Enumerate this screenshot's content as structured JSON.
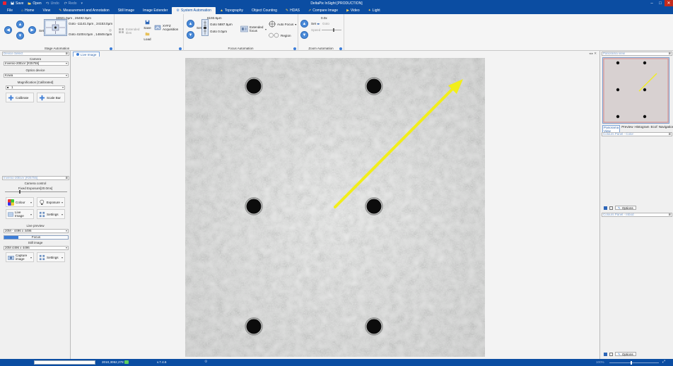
{
  "titlebar": {
    "title": "DeltaPix InSight  [PRODUCTION]",
    "quick": [
      {
        "label": "Save",
        "icon": "save-icon"
      },
      {
        "label": "Open",
        "icon": "folder-icon"
      },
      {
        "label": "Undo",
        "icon": "undo-icon"
      },
      {
        "label": "Redo",
        "icon": "redo-icon"
      }
    ]
  },
  "menu": {
    "tabs": [
      {
        "label": "File",
        "icon": ""
      },
      {
        "label": "Home",
        "icon": "home-icon"
      },
      {
        "label": "View",
        "icon": ""
      },
      {
        "label": "Measurement and Annotation",
        "icon": "ruler-icon"
      },
      {
        "label": "Still Image",
        "icon": ""
      },
      {
        "label": "Image Extender",
        "icon": ""
      },
      {
        "label": "System Automation",
        "icon": "gear-icon"
      },
      {
        "label": "Topography",
        "icon": "mountain-icon"
      },
      {
        "label": "Object Counting",
        "icon": ""
      },
      {
        "label": "HDAS",
        "icon": "pen-icon"
      },
      {
        "label": "Compare Image",
        "icon": "arrow-icon"
      },
      {
        "label": "Video",
        "icon": "video-icon"
      },
      {
        "label": "Light",
        "icon": "bulb-icon"
      }
    ],
    "active_tab": "System Automation"
  },
  "ribbon": {
    "stage": {
      "set_label": "Set",
      "pos_label": "16921.0µm  , 26482.0µm",
      "goto1": "Goto  -11141.0µm  , 24153.0µm",
      "goto2": "Goto  41004.0µm  , 14849.0µm",
      "group_label": "Stage Automation"
    },
    "automation": {
      "extended_tiles": "Extended tiles",
      "save": "Save",
      "load": "Load",
      "xyfz": "XYFZ Acquisition"
    },
    "focus": {
      "set_label": "Set",
      "z_value": "6193.6µm",
      "goto1": "Goto 5887.5µm",
      "goto2": "Goto 0.0µm",
      "extended_focus": "Extended focus",
      "auto_focus": "Auto Focus",
      "region": "Region",
      "group_label": "Focus Automation"
    },
    "zoom": {
      "zoom_value": "0.0x",
      "set_label": "Set",
      "goto_label": "Goto",
      "speed_label": "Speed",
      "group_label": "Zoom Automation"
    }
  },
  "left_panel": {
    "device_search": "Device Select",
    "camera_header": "Camera",
    "camera_value": "Invenio-20EuV  [#25755]",
    "optics_header": "Optics device",
    "optics_value": "Kowa",
    "magnification_header": "Magnification [Calibrated]",
    "magnification_value": "1",
    "calibrate": "Calibrate",
    "scale_bar": "Scale Bar",
    "camera_search": "Invenio-20EuV  [#25755]",
    "camera_control_header": "Camera control",
    "exposure_text": "Fixed Exposure[20.0ms]",
    "colour": "Colour",
    "exposure": "Exposure",
    "live_image": "Live Image",
    "settings": "Settings",
    "live_preview_header": "Live preview",
    "live_preview_value": "20M - 4496 x 4496",
    "focus_label": "Focus",
    "focus_progress": 0.22,
    "still_image_header": "Still image",
    "still_value": "20M 4496 x 4496",
    "capture_image": "Capture image",
    "settings2": "Settings"
  },
  "image_panel": {
    "tab_label": "Live Image"
  },
  "right_panel": {
    "panorama_search": "Panorama view",
    "tabs": [
      "Panorama View",
      "Preview",
      "Histogram",
      "Ecof",
      "Navigation"
    ],
    "colour_search": "Colours Panel - Color",
    "options": "Options",
    "colour_search2": "Colours Panel - Inbod",
    "options2": "Options"
  },
  "statusbar": {
    "coords": "2010,3052,278",
    "version": "v.7.4.6",
    "zoom_pct": "100%"
  },
  "colors": {
    "brand": "#0b4da2",
    "arrow": "#f2ee1a",
    "accent": "#3b7dd8"
  }
}
